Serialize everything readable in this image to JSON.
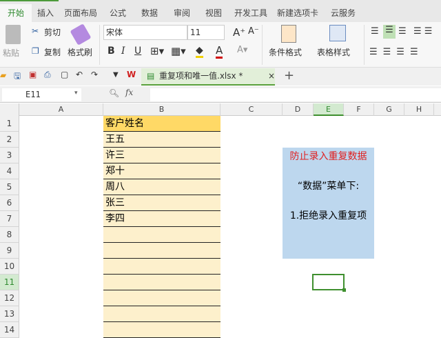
{
  "tabs": [
    "开始",
    "插入",
    "页面布局",
    "公式",
    "数据",
    "审阅",
    "视图",
    "开发工具",
    "新建选项卡",
    "云服务"
  ],
  "ribbon": {
    "paste": "粘贴",
    "cut": "剪切",
    "copy": "复制",
    "format_painter": "格式刷",
    "font": "宋体",
    "font_size": "11",
    "bold": "B",
    "italic": "I",
    "underline": "U",
    "cond_format": "条件格式",
    "table_style": "表格样式"
  },
  "doc_tab": {
    "title": "重复项和唯一值.xlsx *",
    "close": "×",
    "new": "+"
  },
  "formula_bar": {
    "cell_ref": "E11",
    "fx": "fx",
    "value": ""
  },
  "columns": [
    "A",
    "B",
    "C",
    "D",
    "E",
    "F",
    "G",
    "H"
  ],
  "rows": [
    "1",
    "2",
    "3",
    "4",
    "5",
    "6",
    "7",
    "8",
    "9",
    "10",
    "11",
    "12",
    "13",
    "14"
  ],
  "column_b": [
    "客户姓名",
    "王五",
    "许三",
    "郑十",
    "周八",
    "张三",
    "李四",
    "",
    "",
    "",
    "",
    "",
    "",
    ""
  ],
  "note": {
    "title": "防止录入重复数据",
    "line1": "“数据”菜单下:",
    "line2": "1.拒绝录入重复项"
  },
  "colors": {
    "accent": "#2f8a2f",
    "note_bg": "#bdd7ee",
    "header_fill": "#ffd966",
    "cell_fill": "#fdf0cc",
    "note_title": "#e02020"
  }
}
